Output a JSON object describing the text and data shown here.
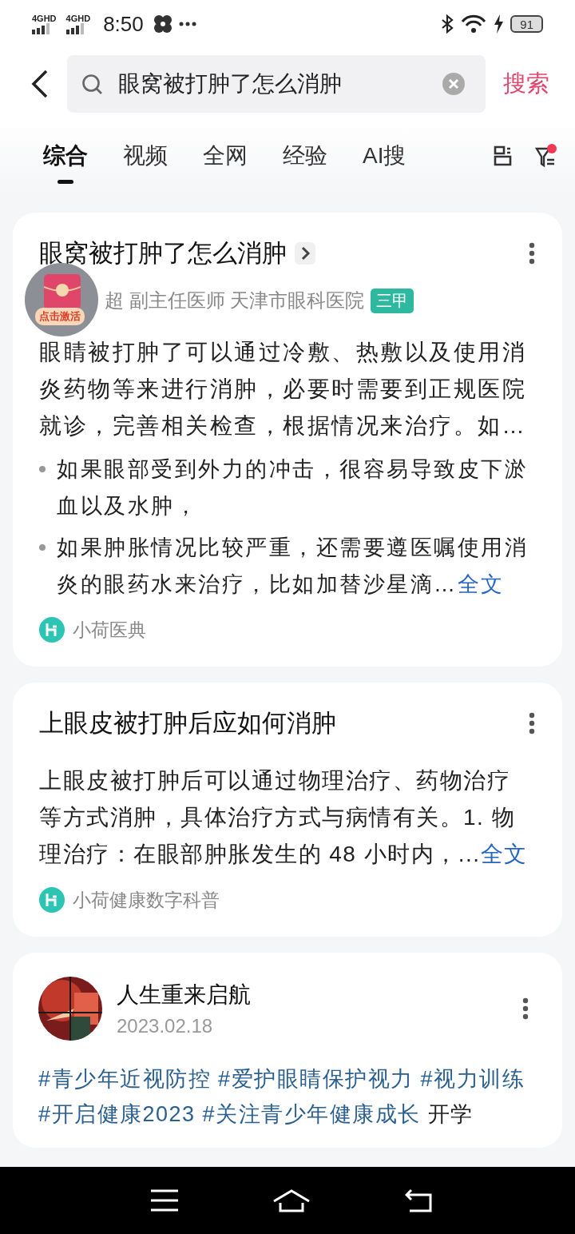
{
  "status_bar": {
    "signal_labels": [
      "4GHD",
      "4GHD"
    ],
    "time": "8:50",
    "battery": "91"
  },
  "header": {
    "query": "眼窝被打肿了怎么消肿",
    "search_button": "搜索"
  },
  "tabs": [
    {
      "label": "综合",
      "selected": true
    },
    {
      "label": "视频",
      "selected": false
    },
    {
      "label": "全网",
      "selected": false
    },
    {
      "label": "经验",
      "selected": false
    },
    {
      "label": "AI搜",
      "selected": false
    }
  ],
  "filter": {
    "has_notice": true
  },
  "results": [
    {
      "title": "眼窝被打肿了怎么消肿",
      "author": "超 副主任医师 天津市眼科医院",
      "author_badge": "三甲",
      "summary": "眼睛被打肿了可以通过冷敷、热敷以及使用消炎药物等来进行消肿，必要时需要到正规医院就诊，完善相关检查，根据情况来治疗。如…",
      "bullets": [
        "如果眼部受到外力的冲击，很容易导致皮下淤血以及水肿，",
        "如果肿胀情况比较严重，还需要遵医嘱使用消炎的眼药水来治疗，比如加替沙星滴…"
      ],
      "more_link": "全文",
      "source": "小荷医典"
    },
    {
      "title": "上眼皮被打肿后应如何消肿",
      "summary": "上眼皮被打肿后可以通过物理治疗、药物治疗等方式消肿，具体治疗方式与病情有关。1. 物理治疗：在眼部肿胀发生的 48 小时内，...",
      "more_link": "全文",
      "source": "小荷健康数字科普"
    }
  ],
  "post": {
    "author": "人生重来启航",
    "date": "2023.02.18",
    "segments": [
      {
        "text": "#青少年近视防控 ",
        "kind": "tag"
      },
      {
        "text": "#爱护眼睛保护视力 ",
        "kind": "tag"
      },
      {
        "text": "#视力训练 ",
        "kind": "tag"
      },
      {
        "text": "#开启健康2023 ",
        "kind": "tag"
      },
      {
        "text": "#关注青少年健康成长",
        "kind": "tag"
      },
      {
        "text": " 开学",
        "kind": "plain"
      }
    ]
  },
  "floating_badge": {
    "label": "点击激活"
  }
}
